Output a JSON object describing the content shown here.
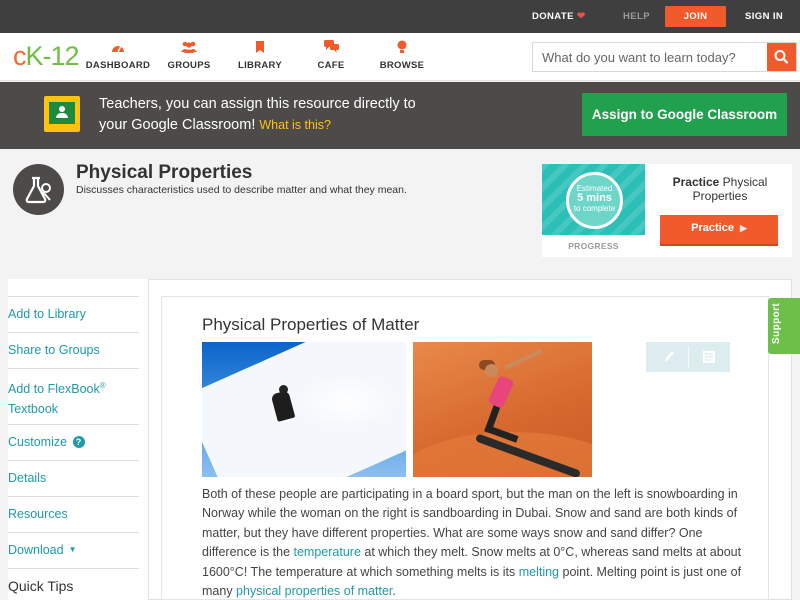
{
  "topbar": {
    "donate": "DONATE",
    "help": "HELP",
    "join": "JOIN",
    "sign_in": "SIGN IN"
  },
  "nav": {
    "logo_c": "c",
    "logo_k": "K",
    "logo_n": "-12",
    "items": [
      {
        "label": "DASHBOARD",
        "icon": "dashboard-icon"
      },
      {
        "label": "GROUPS",
        "icon": "groups-icon"
      },
      {
        "label": "LIBRARY",
        "icon": "library-icon"
      },
      {
        "label": "CAFE",
        "icon": "cafe-icon"
      },
      {
        "label": "BROWSE",
        "icon": "browse-icon"
      }
    ],
    "search_placeholder": "What do you want to learn today?"
  },
  "banner": {
    "text": "Teachers, you can assign this resource directly to your Google Classroom!",
    "what_is_this": "What is this?",
    "assign_button": "Assign to Google Classroom"
  },
  "concept": {
    "title": "Physical Properties",
    "subtitle": "Discusses characteristics used to describe matter and what they mean."
  },
  "practice": {
    "estimated": "Estimated",
    "mins": "5 mins",
    "to_complete": "to complete",
    "progress_label": "PROGRESS",
    "label_bold": "Practice",
    "label_rest": " Physical Properties",
    "button": "Practice"
  },
  "sidebar": {
    "add_library": "Add to Library",
    "share_groups": "Share to Groups",
    "add_flexbook": "Add to FlexBook",
    "flexbook_reg": "®",
    "textbook": "Textbook",
    "customize": "Customize",
    "customize_help": "?",
    "details": "Details",
    "resources": "Resources",
    "download": "Download",
    "quick_tips": "Quick Tips"
  },
  "article": {
    "title": "Physical Properties of Matter",
    "p1": "Both of these people are participating in a board sport, but the man on the left is snowboarding in Norway while the woman on the right is sandboarding in Dubai. Snow and sand are both kinds of matter, but they have different properties. What are some ways snow and sand differ? One difference is the ",
    "link_temperature": "temperature",
    "p2": " at which they melt. Snow melts at 0°C, whereas sand melts at about 1600°C! The temperature at which something melts is its ",
    "link_melting": "melting",
    "p3": " point. Melting point is just one of many ",
    "link_physical": "physical properties of matter",
    "p4": "."
  },
  "support": "Support",
  "colors": {
    "accent": "#f15a2b",
    "brand_green": "#6fbe44",
    "link": "#1e9aa8",
    "classroom_green": "#21a04d"
  }
}
